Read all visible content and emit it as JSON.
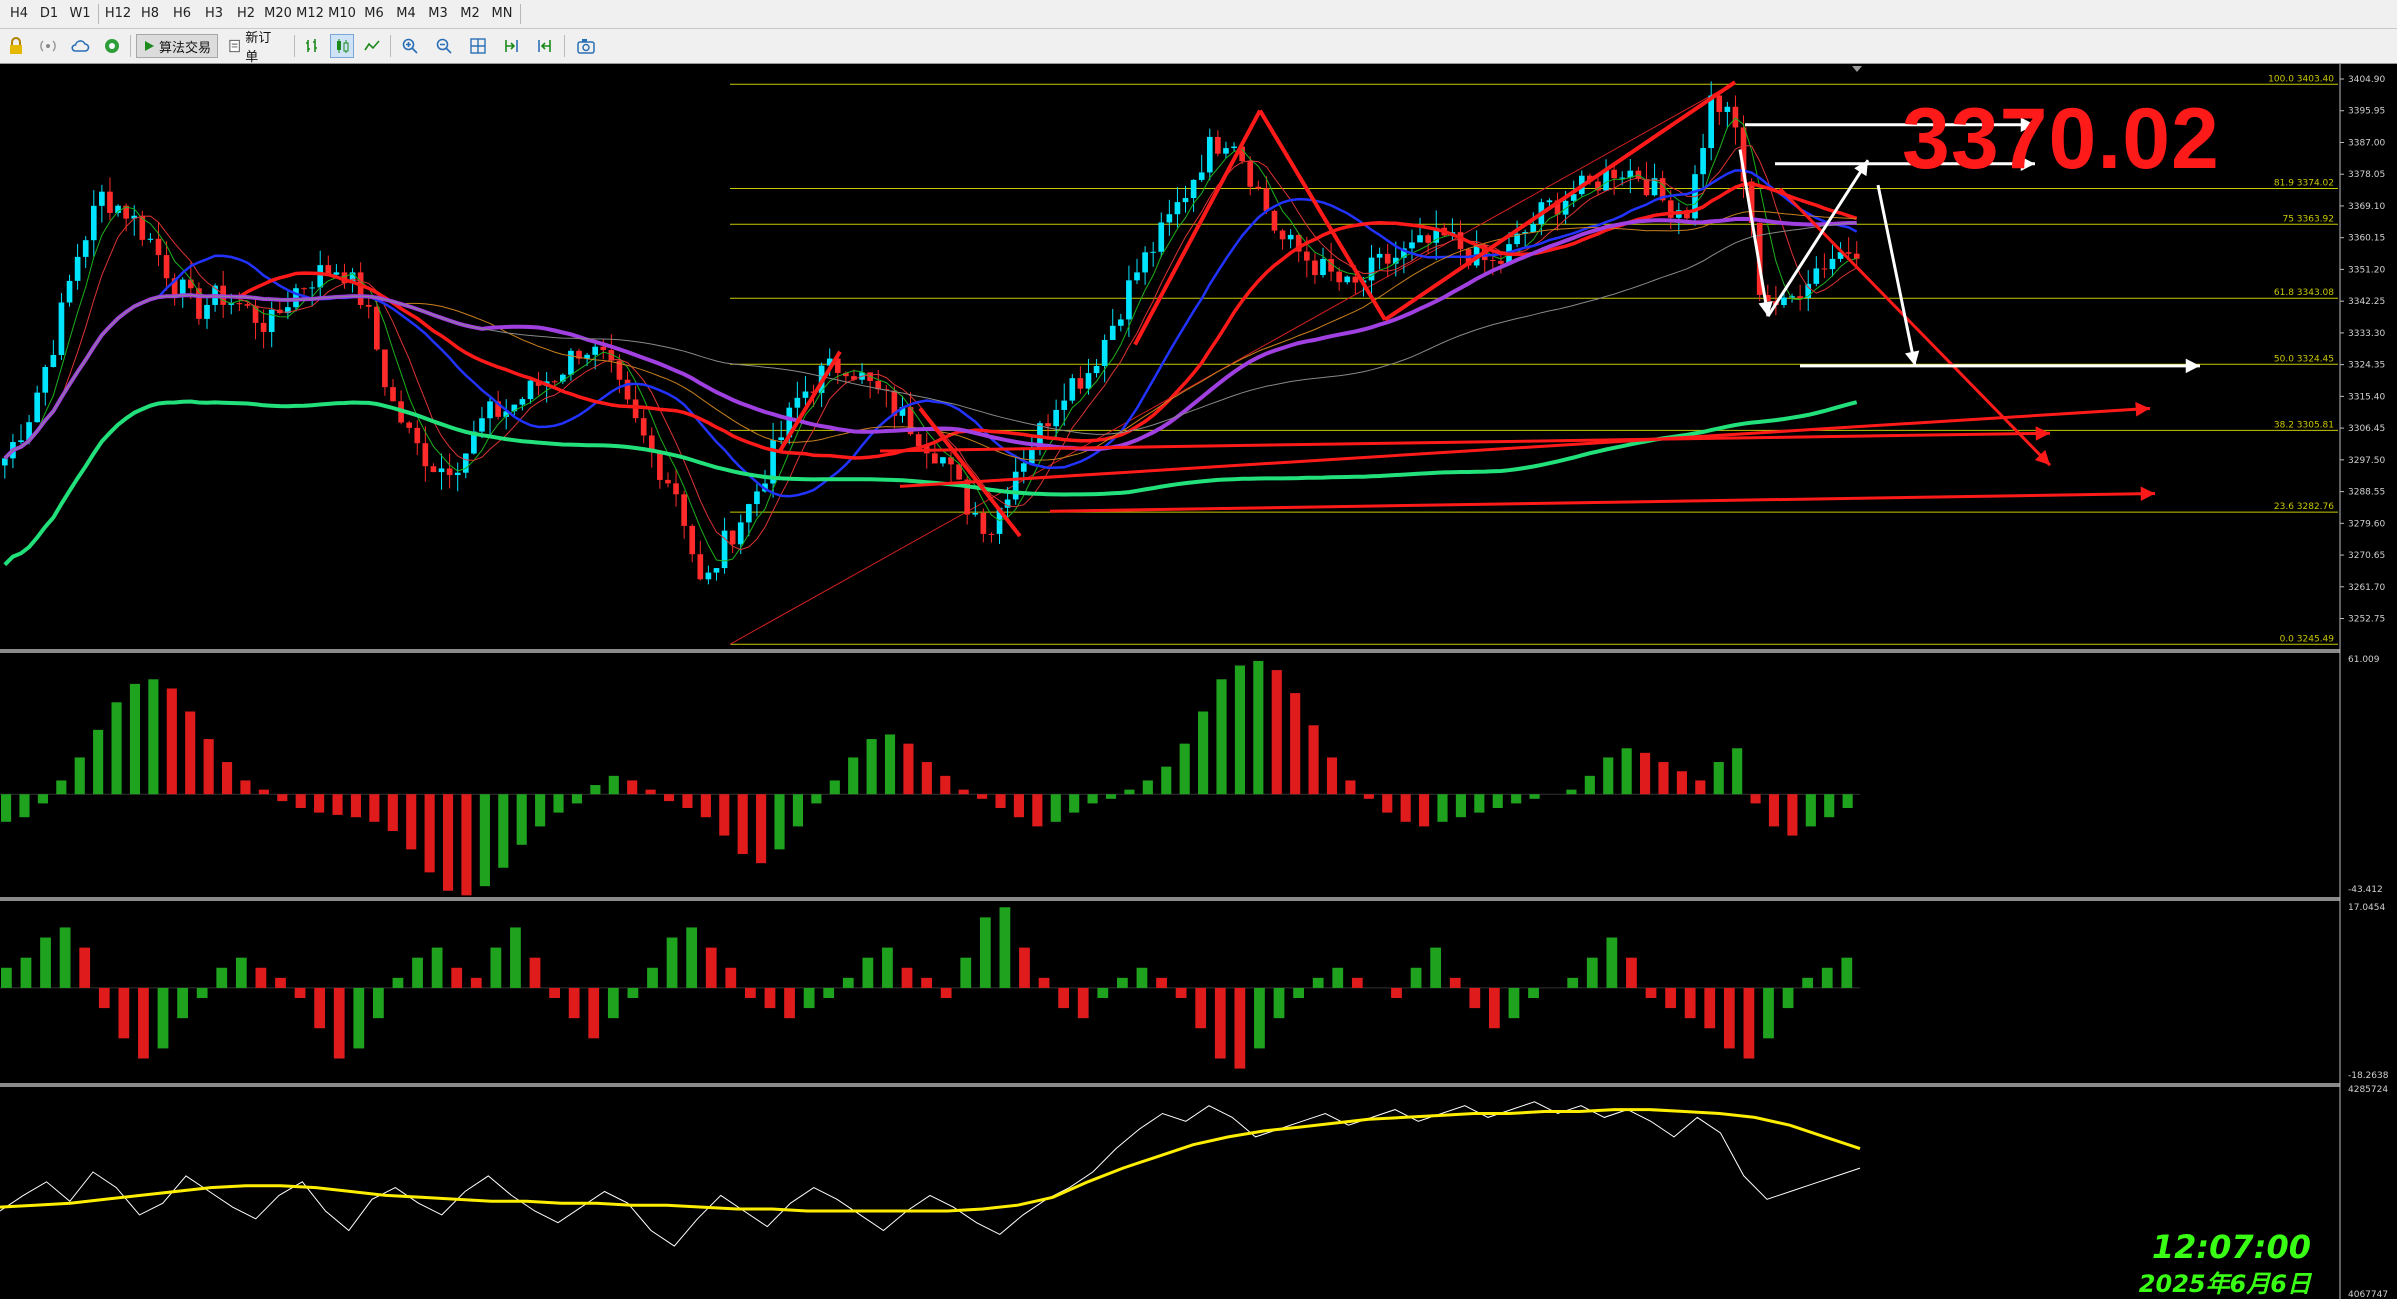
{
  "timeframes": [
    "H4",
    "D1",
    "W1",
    "H12",
    "H8",
    "H6",
    "H3",
    "H2",
    "M20",
    "M12",
    "M10",
    "M6",
    "M4",
    "M3",
    "M2",
    "MN"
  ],
  "toolbar": {
    "algo_trading_label": "算法交易",
    "new_order_label": "新订单",
    "icons": [
      "lock-icon",
      "signal-icon",
      "cloud-icon",
      "globe-icon",
      "play-icon",
      "order-icon",
      "bar-chart-icon",
      "candlestick-icon",
      "line-chart-icon",
      "zoom-in-icon",
      "zoom-out-icon",
      "grid-icon",
      "autoscroll-icon",
      "shift-icon",
      "screenshot-icon"
    ]
  },
  "annotation": {
    "price_callout": "3370.02"
  },
  "clock": {
    "time": "12:07:00",
    "date": "2025年6月6日"
  },
  "colors": {
    "background": "#000000",
    "bull": "#00e5ff",
    "bear": "#ff2a2a",
    "fib": "#c8c800",
    "ma_red": "#ff1a1a",
    "ma_blue": "#2233ff",
    "ma_purple": "#a040e0",
    "ma_green": "#22e07a",
    "macd_up": "#1fa31f",
    "macd_down": "#e01b1b",
    "volume_line": "#ffffff",
    "volume_ma": "#ffee00",
    "clock": "#39ff14"
  },
  "chart_data": [
    {
      "type": "candlestick",
      "title": "",
      "y_axis_ticks": [
        "3404.90",
        "3395.95",
        "3387.00",
        "3378.05",
        "3369.10",
        "3360.15",
        "3351.20",
        "3342.25",
        "3333.30",
        "3324.35",
        "3315.40",
        "3306.45",
        "3297.50",
        "3288.55",
        "3279.60",
        "3270.65",
        "3261.70",
        "3252.75"
      ],
      "ylim": [
        3245,
        3408
      ],
      "fib_levels": [
        {
          "label": "100.0",
          "price": 3403.4
        },
        {
          "label": "81.9",
          "price": 3374.02
        },
        {
          "label": "75",
          "price": 3363.92
        },
        {
          "label": "61.8",
          "price": 3343.08
        },
        {
          "label": "50.0",
          "price": 3324.45
        },
        {
          "label": "38.2",
          "price": 3305.81
        },
        {
          "label": "23.6",
          "price": 3282.76
        },
        {
          "label": "0.0",
          "price": 3245.49
        }
      ],
      "fib_label_texts": [
        "100.0 3403.40",
        "81.9 3374.02",
        "75 3363.92",
        "61.8 3343.08",
        "50.0 3324.45",
        "38.2 3305.81",
        "23.6 3282.76",
        "0.0 3245.49"
      ],
      "annotation_price": 3370.02,
      "close_path": [
        3298,
        3310,
        3330,
        3355,
        3372,
        3368,
        3360,
        3348,
        3340,
        3344,
        3340,
        3335,
        3345,
        3350,
        3352,
        3341,
        3315,
        3302,
        3295,
        3298,
        3310,
        3312,
        3318,
        3322,
        3330,
        3325,
        3310,
        3298,
        3288,
        3260,
        3275,
        3285,
        3300,
        3315,
        3322,
        3325,
        3318,
        3312,
        3305,
        3298,
        3285,
        3278,
        3295,
        3305,
        3318,
        3322,
        3335,
        3350,
        3360,
        3372,
        3385,
        3390,
        3375,
        3360,
        3355,
        3350,
        3345,
        3352,
        3355,
        3358,
        3360,
        3355,
        3352,
        3360,
        3368,
        3372,
        3375,
        3380,
        3378,
        3370,
        3368,
        3400,
        3390,
        3345,
        3340,
        3350,
        3355,
        3358
      ]
    },
    {
      "type": "bar",
      "title": "",
      "y_axis_ticks": [
        "61.009",
        "-43.412"
      ],
      "ylim": [
        -43.412,
        61.009
      ],
      "values": [
        -12,
        -10,
        -4,
        6,
        16,
        28,
        40,
        48,
        50,
        46,
        36,
        24,
        14,
        6,
        2,
        -3,
        -6,
        -8,
        -9,
        -10,
        -12,
        -16,
        -24,
        -34,
        -42,
        -44,
        -40,
        -32,
        -22,
        -14,
        -8,
        -4,
        4,
        8,
        6,
        2,
        -3,
        -6,
        -10,
        -18,
        -26,
        -30,
        -24,
        -14,
        -4,
        6,
        16,
        24,
        26,
        22,
        14,
        8,
        2,
        -2,
        -6,
        -10,
        -14,
        -12,
        -8,
        -4,
        -2,
        2,
        6,
        12,
        22,
        36,
        50,
        56,
        58,
        54,
        44,
        30,
        16,
        6,
        -2,
        -8,
        -12,
        -14,
        -12,
        -10,
        -8,
        -6,
        -4,
        -2,
        0,
        2,
        8,
        16,
        20,
        18,
        14,
        10,
        6,
        14,
        20,
        -4,
        -14,
        -18,
        -14,
        -10,
        -6
      ]
    },
    {
      "type": "bar",
      "title": "",
      "y_axis_ticks": [
        "17.0454",
        "-18.2638"
      ],
      "ylim": [
        -18.2638,
        17.0454
      ],
      "values": [
        4,
        6,
        10,
        12,
        8,
        -4,
        -10,
        -14,
        -12,
        -6,
        -2,
        4,
        6,
        4,
        2,
        -2,
        -8,
        -14,
        -12,
        -6,
        2,
        6,
        8,
        4,
        2,
        8,
        12,
        6,
        -2,
        -6,
        -10,
        -6,
        -2,
        4,
        10,
        12,
        8,
        4,
        -2,
        -4,
        -6,
        -4,
        -2,
        2,
        6,
        8,
        4,
        2,
        -2,
        6,
        14,
        16,
        8,
        2,
        -4,
        -6,
        -2,
        2,
        4,
        2,
        -2,
        -8,
        -14,
        -16,
        -12,
        -6,
        -2,
        2,
        4,
        2,
        0,
        -2,
        4,
        8,
        2,
        -4,
        -8,
        -6,
        -2,
        0,
        2,
        6,
        10,
        6,
        -2,
        -4,
        -6,
        -8,
        -12,
        -14,
        -10,
        -4,
        2,
        4,
        6
      ]
    },
    {
      "type": "line",
      "title": "",
      "y_axis_ticks": [
        "4285724",
        "4067747"
      ],
      "ylim": [
        4067747,
        4285724
      ],
      "series": [
        {
          "values": [
            0.4,
            0.48,
            0.55,
            0.45,
            0.6,
            0.52,
            0.38,
            0.44,
            0.58,
            0.5,
            0.42,
            0.36,
            0.48,
            0.55,
            0.4,
            0.3,
            0.46,
            0.52,
            0.44,
            0.38,
            0.5,
            0.58,
            0.48,
            0.4,
            0.34,
            0.42,
            0.5,
            0.44,
            0.3,
            0.22,
            0.36,
            0.48,
            0.4,
            0.32,
            0.44,
            0.52,
            0.46,
            0.38,
            0.3,
            0.4,
            0.48,
            0.42,
            0.34,
            0.28,
            0.38,
            0.46,
            0.52,
            0.6,
            0.72,
            0.82,
            0.9,
            0.86,
            0.94,
            0.88,
            0.78,
            0.82,
            0.86,
            0.9,
            0.84,
            0.88,
            0.92,
            0.86,
            0.9,
            0.94,
            0.88,
            0.92,
            0.96,
            0.9,
            0.94,
            0.88,
            0.92,
            0.86,
            0.78,
            0.88,
            0.8,
            0.58,
            0.46,
            0.5,
            0.54,
            0.58,
            0.62
          ]
        },
        {
          "values": [
            0.42,
            0.43,
            0.44,
            0.46,
            0.48,
            0.5,
            0.52,
            0.53,
            0.53,
            0.52,
            0.5,
            0.48,
            0.47,
            0.46,
            0.45,
            0.45,
            0.44,
            0.44,
            0.43,
            0.43,
            0.42,
            0.41,
            0.41,
            0.4,
            0.4,
            0.4,
            0.4,
            0.4,
            0.41,
            0.43,
            0.47,
            0.55,
            0.62,
            0.68,
            0.74,
            0.78,
            0.81,
            0.83,
            0.85,
            0.87,
            0.88,
            0.89,
            0.9,
            0.9,
            0.91,
            0.91,
            0.92,
            0.92,
            0.91,
            0.9,
            0.88,
            0.84,
            0.78,
            0.72
          ]
        }
      ]
    }
  ]
}
